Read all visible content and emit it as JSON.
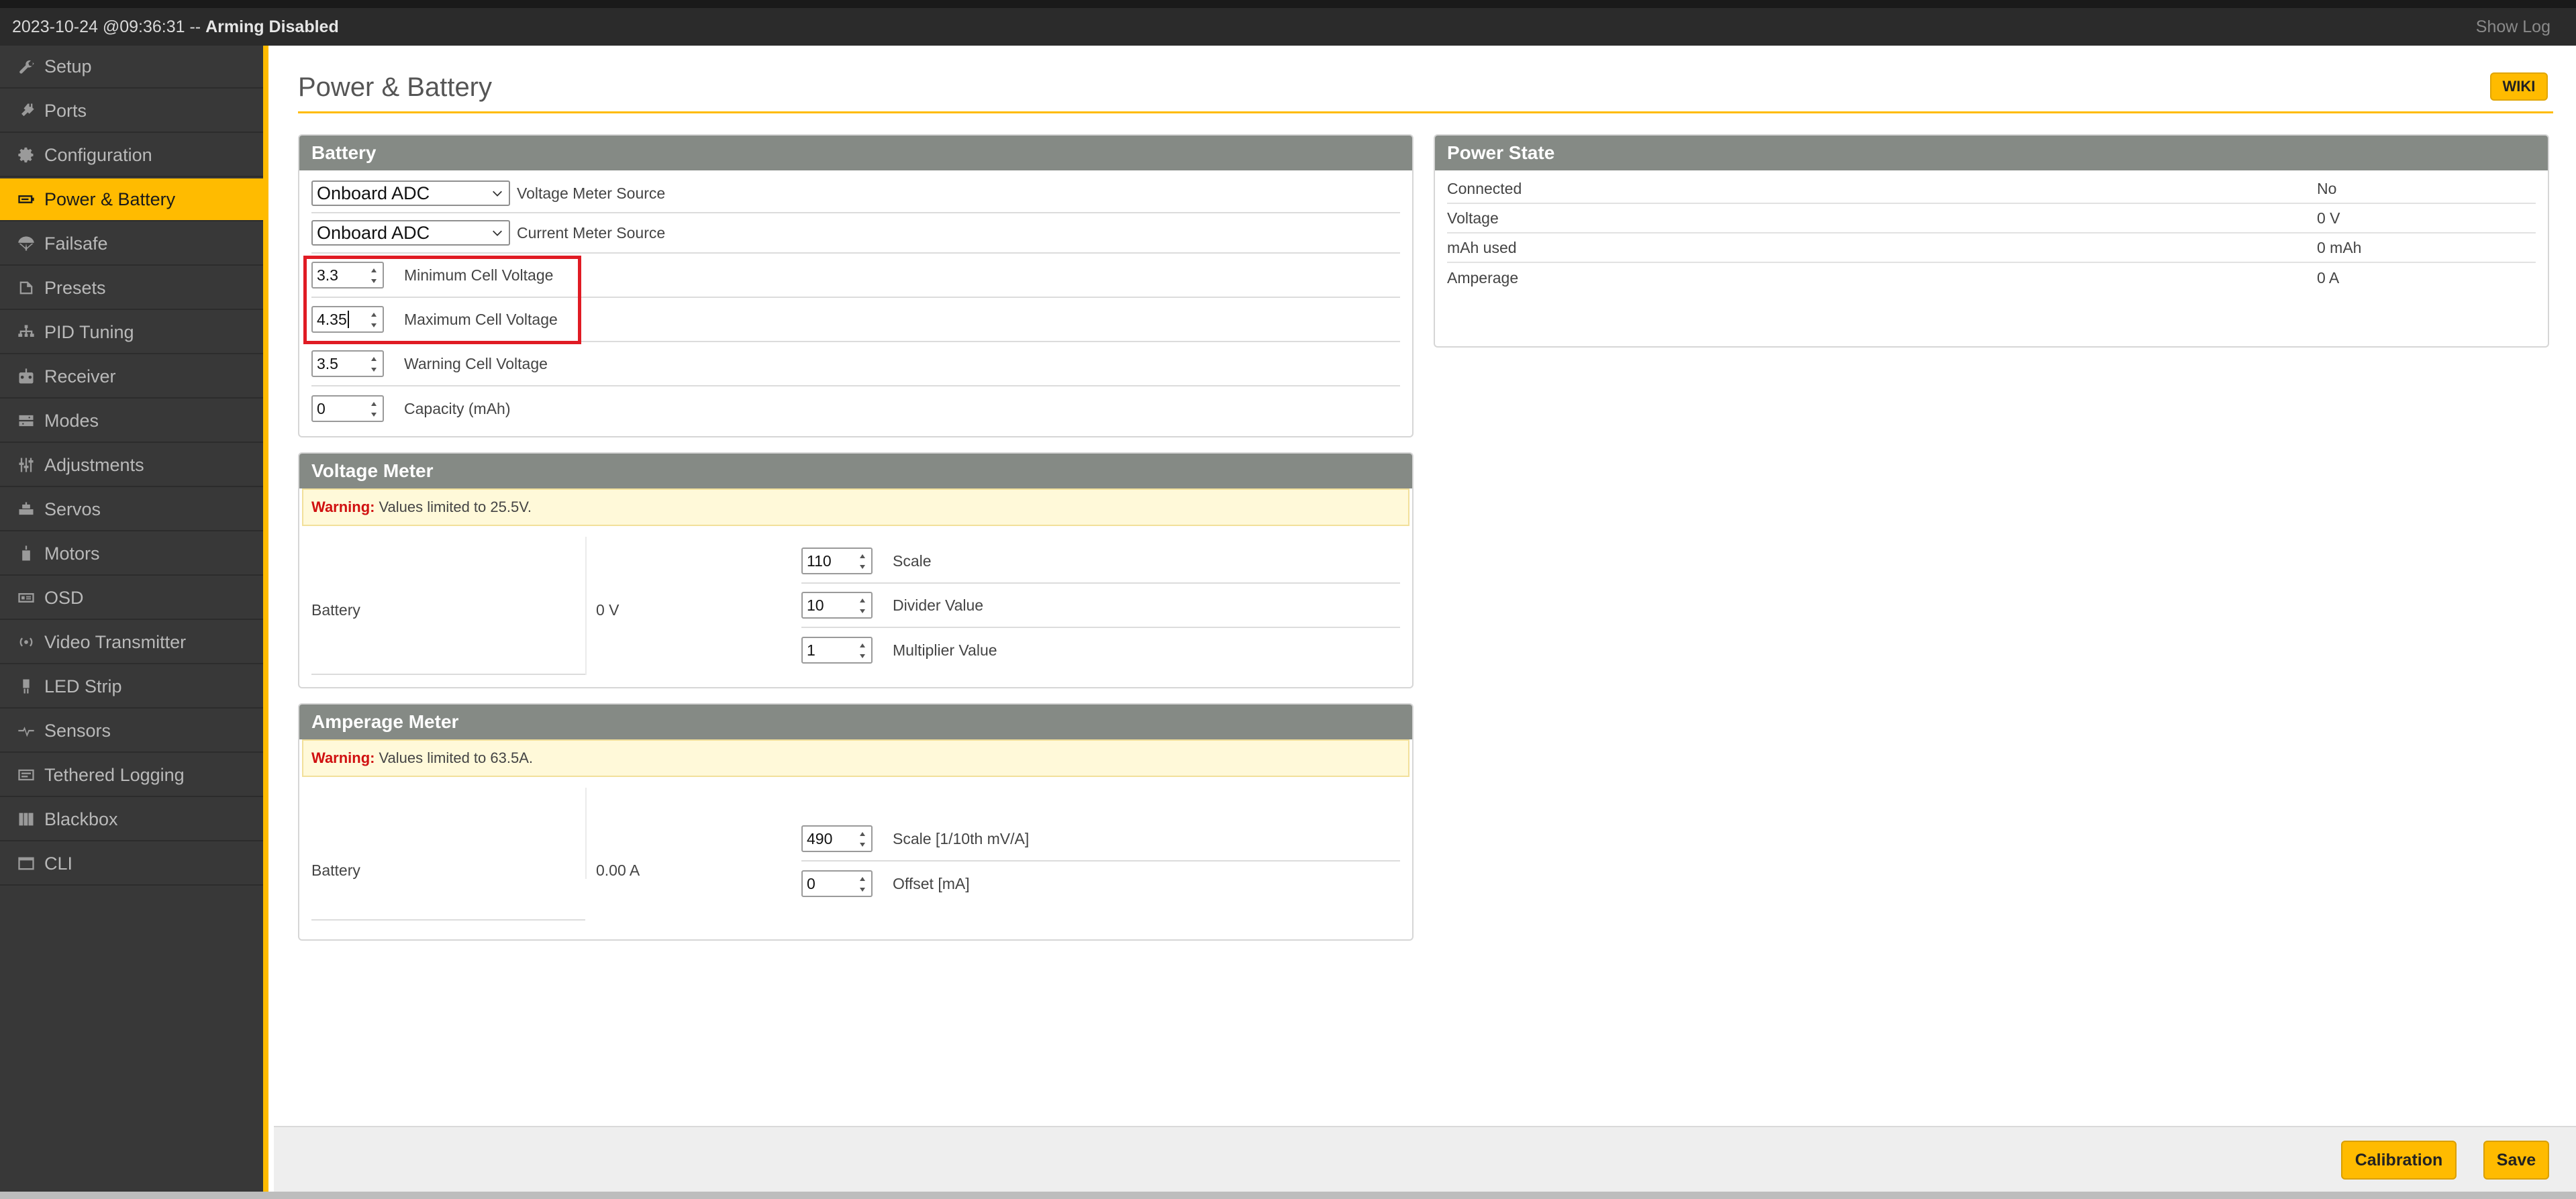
{
  "topbar": {
    "timestamp": "2023-10-24 @09:36:31",
    "separator": " -- ",
    "arming_status": "Arming Disabled",
    "show_log": "Show Log"
  },
  "sidebar": {
    "items": [
      {
        "label": "Setup",
        "icon": "wrench-icon"
      },
      {
        "label": "Ports",
        "icon": "plug-icon"
      },
      {
        "label": "Configuration",
        "icon": "gear-icon"
      },
      {
        "label": "Power & Battery",
        "icon": "battery-icon",
        "active": true
      },
      {
        "label": "Failsafe",
        "icon": "parachute-icon"
      },
      {
        "label": "Presets",
        "icon": "presets-icon"
      },
      {
        "label": "PID Tuning",
        "icon": "pid-icon"
      },
      {
        "label": "Receiver",
        "icon": "receiver-icon"
      },
      {
        "label": "Modes",
        "icon": "modes-icon"
      },
      {
        "label": "Adjustments",
        "icon": "sliders-icon"
      },
      {
        "label": "Servos",
        "icon": "servo-icon"
      },
      {
        "label": "Motors",
        "icon": "motor-icon"
      },
      {
        "label": "OSD",
        "icon": "osd-icon"
      },
      {
        "label": "Video Transmitter",
        "icon": "antenna-icon"
      },
      {
        "label": "LED Strip",
        "icon": "led-icon"
      },
      {
        "label": "Sensors",
        "icon": "sensor-wave-icon"
      },
      {
        "label": "Tethered Logging",
        "icon": "logging-icon"
      },
      {
        "label": "Blackbox",
        "icon": "blackbox-icon"
      },
      {
        "label": "CLI",
        "icon": "terminal-icon"
      }
    ]
  },
  "page": {
    "title": "Power & Battery",
    "wiki": "WIKI"
  },
  "battery": {
    "title": "Battery",
    "voltage_source": {
      "value": "Onboard ADC",
      "label": "Voltage Meter Source"
    },
    "current_source": {
      "value": "Onboard ADC",
      "label": "Current Meter Source"
    },
    "min_cell": {
      "value": "3.3",
      "label": "Minimum Cell Voltage"
    },
    "max_cell": {
      "value": "4.35",
      "label": "Maximum Cell Voltage"
    },
    "warn_cell": {
      "value": "3.5",
      "label": "Warning Cell Voltage"
    },
    "capacity": {
      "value": "0",
      "label": "Capacity (mAh)"
    }
  },
  "voltage_meter": {
    "title": "Voltage Meter",
    "warning_label": "Warning:",
    "warning_text": "Values limited to 25.5V.",
    "name": "Battery",
    "reading": "0 V",
    "scale": {
      "value": "110",
      "label": "Scale"
    },
    "divider": {
      "value": "10",
      "label": "Divider Value"
    },
    "multiplier": {
      "value": "1",
      "label": "Multiplier Value"
    }
  },
  "amperage_meter": {
    "title": "Amperage Meter",
    "warning_label": "Warning:",
    "warning_text": "Values limited to 63.5A.",
    "name": "Battery",
    "reading": "0.00 A",
    "scale": {
      "value": "490",
      "label": "Scale [1/10th mV/A]"
    },
    "offset": {
      "value": "0",
      "label": "Offset [mA]"
    }
  },
  "power_state": {
    "title": "Power State",
    "rows": [
      {
        "label": "Connected",
        "value": "No"
      },
      {
        "label": "Voltage",
        "value": "0 V"
      },
      {
        "label": "mAh used",
        "value": "0 mAh"
      },
      {
        "label": "Amperage",
        "value": "0 A"
      }
    ]
  },
  "footer": {
    "calibration": "Calibration",
    "save": "Save"
  },
  "colors": {
    "accent": "#ffbb00",
    "sidebar_bg": "#383838",
    "panel_header": "#858a85",
    "warning_red": "#d01010",
    "highlight_red": "#e01b24"
  }
}
